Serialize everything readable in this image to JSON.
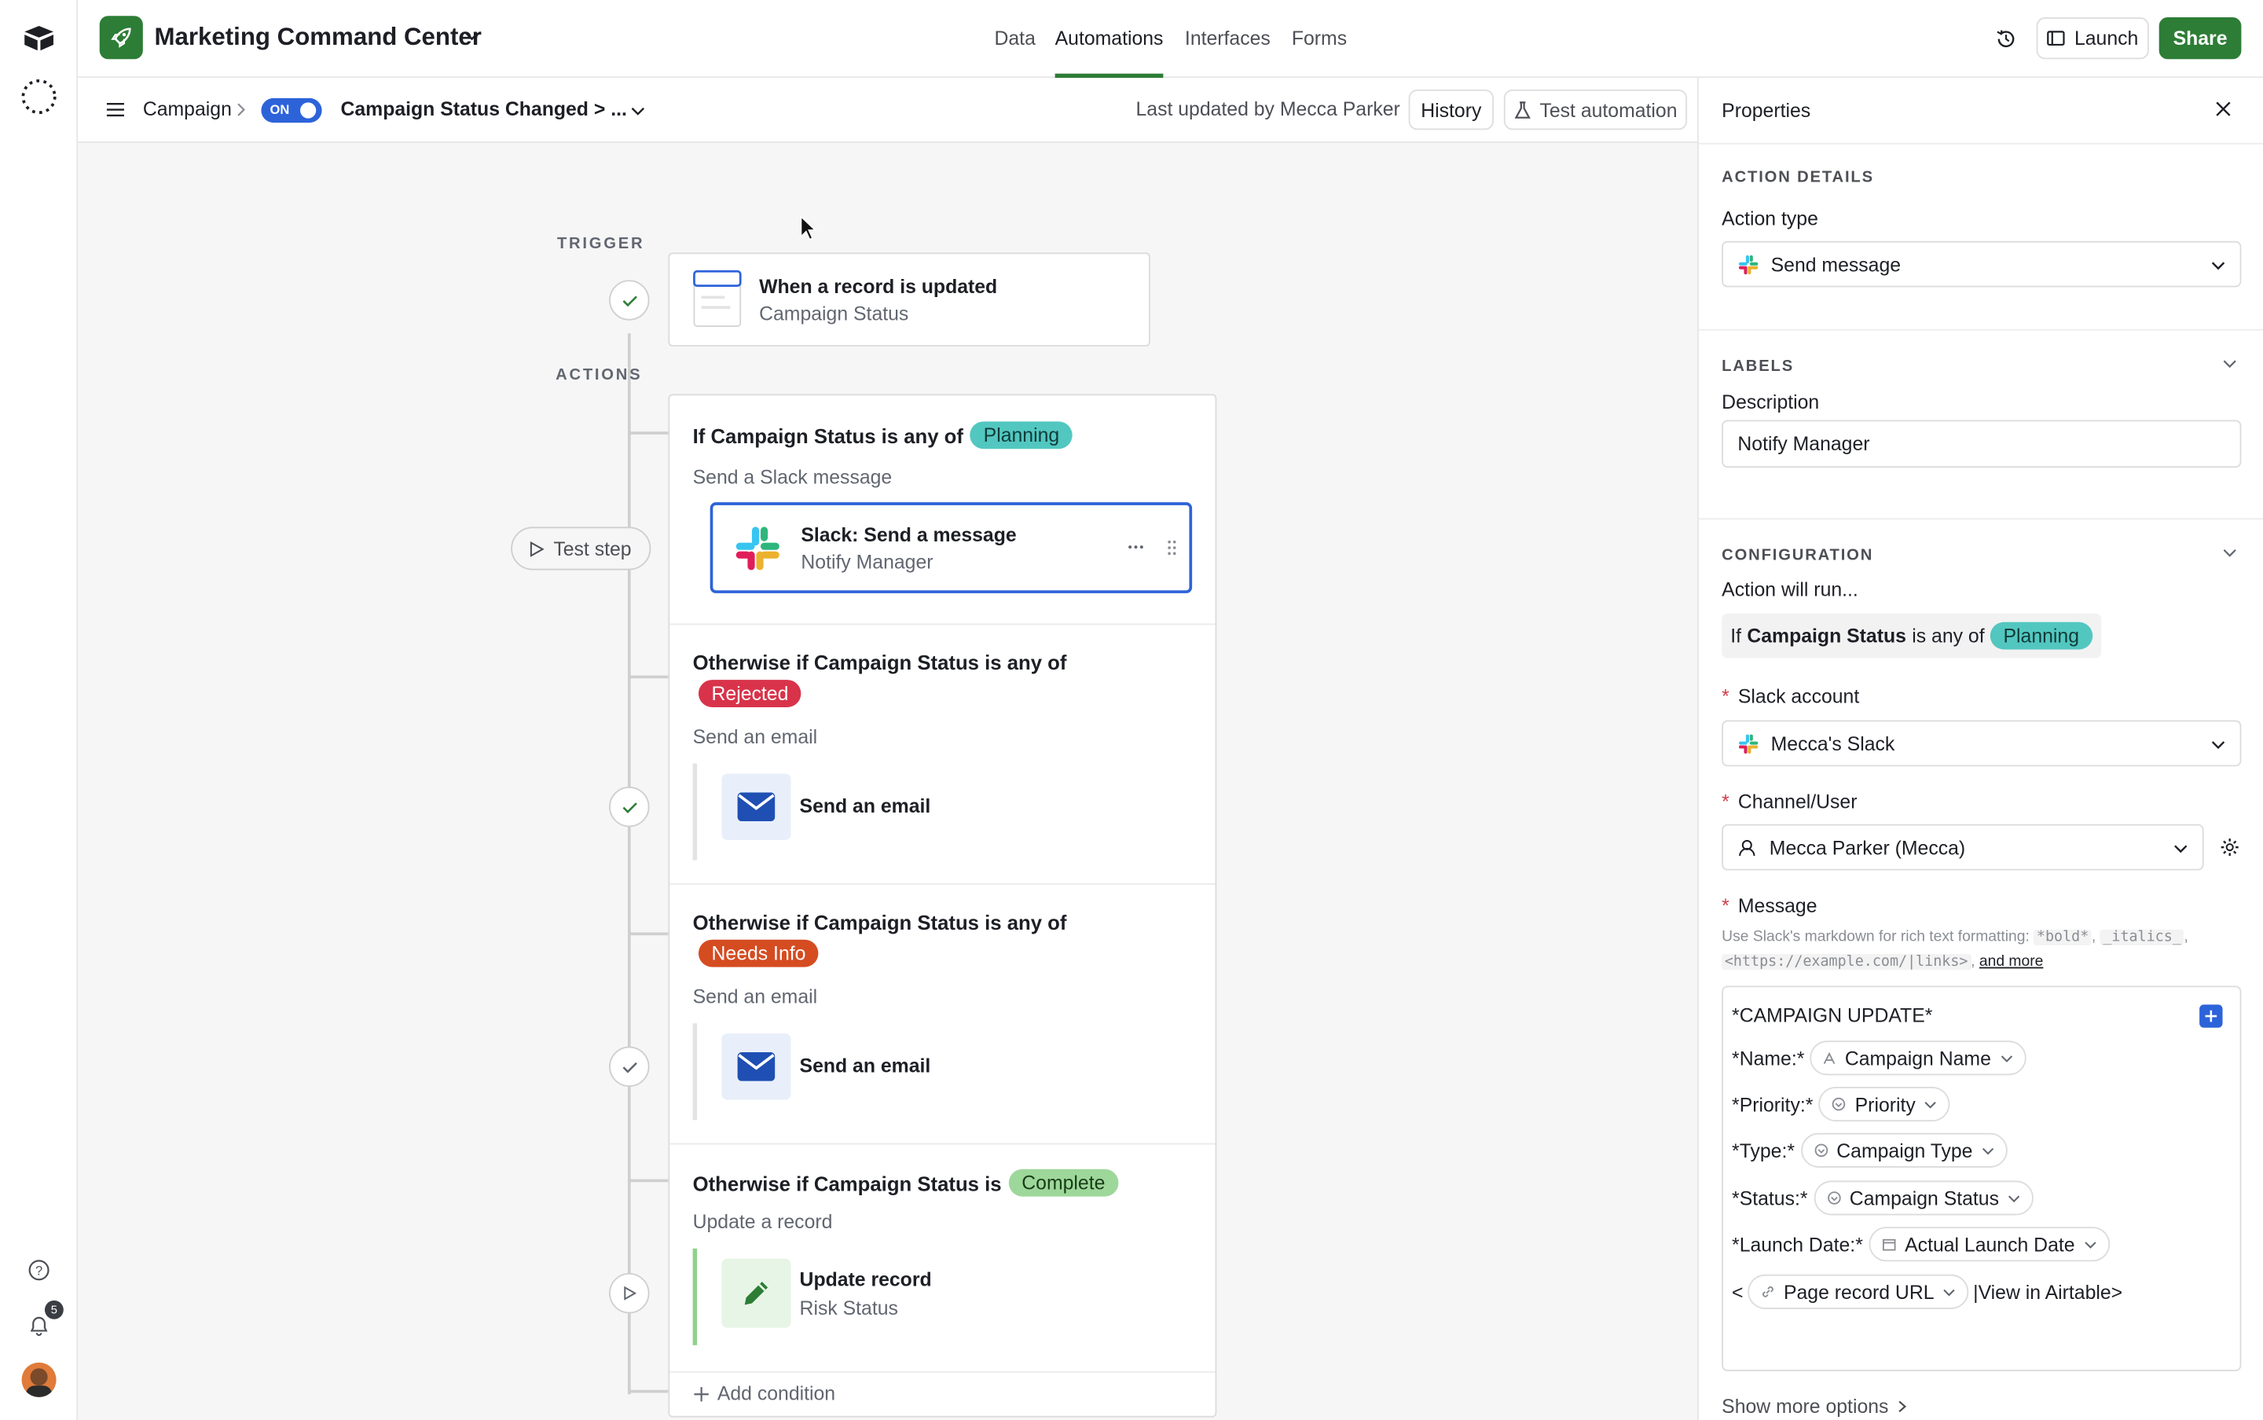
{
  "app": {
    "base_name": "Marketing Command Center",
    "nav_tabs": [
      "Data",
      "Automations",
      "Interfaces",
      "Forms"
    ],
    "active_tab": "Automations",
    "launch_label": "Launch",
    "share_label": "Share",
    "brand_color": "#2d7d36",
    "notification_count": "5"
  },
  "subbar": {
    "table": "Campaign",
    "toggle_label": "ON",
    "automation_name": "Campaign Status Changed > ...",
    "last_updated": "Last updated by Mecca Parker",
    "history_label": "History",
    "test_label": "Test automation"
  },
  "flow": {
    "trigger_heading": "TRIGGER",
    "trigger_title": "When a record is updated",
    "trigger_sub": "Campaign Status",
    "actions_heading": "ACTIONS",
    "test_step_label": "Test step",
    "add_condition": "Add condition",
    "branches": [
      {
        "prefix": "If Campaign Status is any of",
        "pill": "Planning",
        "pill_color": "#52c7c0",
        "action_heading": "Send a Slack message",
        "action_title": "Slack: Send a message",
        "action_sub": "Notify Manager"
      },
      {
        "prefix": "Otherwise if Campaign Status is any of",
        "pill": "Rejected",
        "pill_color": "#d8334a",
        "action_heading": "Send an email",
        "action_title": "Send an email"
      },
      {
        "prefix": "Otherwise if Campaign Status is any of",
        "pill": "Needs Info",
        "pill_color": "#d54c21",
        "action_heading": "Send an email",
        "action_title": "Send an email"
      },
      {
        "prefix": "Otherwise if Campaign Status is",
        "pill": "Complete",
        "pill_color": "#9ed79a",
        "action_heading": "Update a record",
        "action_title": "Update record",
        "action_sub": "Risk Status"
      }
    ]
  },
  "properties": {
    "title": "Properties",
    "action_details_heading": "ACTION DETAILS",
    "action_type_label": "Action type",
    "action_type_value": "Send message",
    "labels_heading": "LABELS",
    "description_label": "Description",
    "description_value": "Notify Manager",
    "configuration_heading": "CONFIGURATION",
    "action_will_run": "Action will run...",
    "condition_prefix": "If",
    "condition_field": "Campaign Status",
    "condition_op": "is any of",
    "condition_value": "Planning",
    "slack_account_label": "Slack account",
    "slack_account_value": "Mecca's Slack",
    "channel_label": "Channel/User",
    "channel_value": "Mecca Parker (Mecca)",
    "message_label": "Message",
    "message_help_1": "Use Slack's markdown for rich text formatting:",
    "message_help_bold": "*bold*",
    "message_help_italics": "_italics_",
    "message_help_link": "<https://example.com/|links>",
    "message_help_more": "and more",
    "message": {
      "line1": "*CAMPAIGN UPDATE*",
      "rows": [
        {
          "label": "*Name:*",
          "token": "Campaign Name"
        },
        {
          "label": "*Priority:*",
          "token": "Priority"
        },
        {
          "label": "*Type:*",
          "token": "Campaign Type"
        },
        {
          "label": "*Status:*",
          "token": "Campaign Status"
        },
        {
          "label": "*Launch Date:*",
          "token": "Actual Launch Date"
        }
      ],
      "url_prefix": "<",
      "url_token": "Page record URL",
      "url_suffix": "|View in Airtable>"
    },
    "show_more": "Show more options"
  }
}
